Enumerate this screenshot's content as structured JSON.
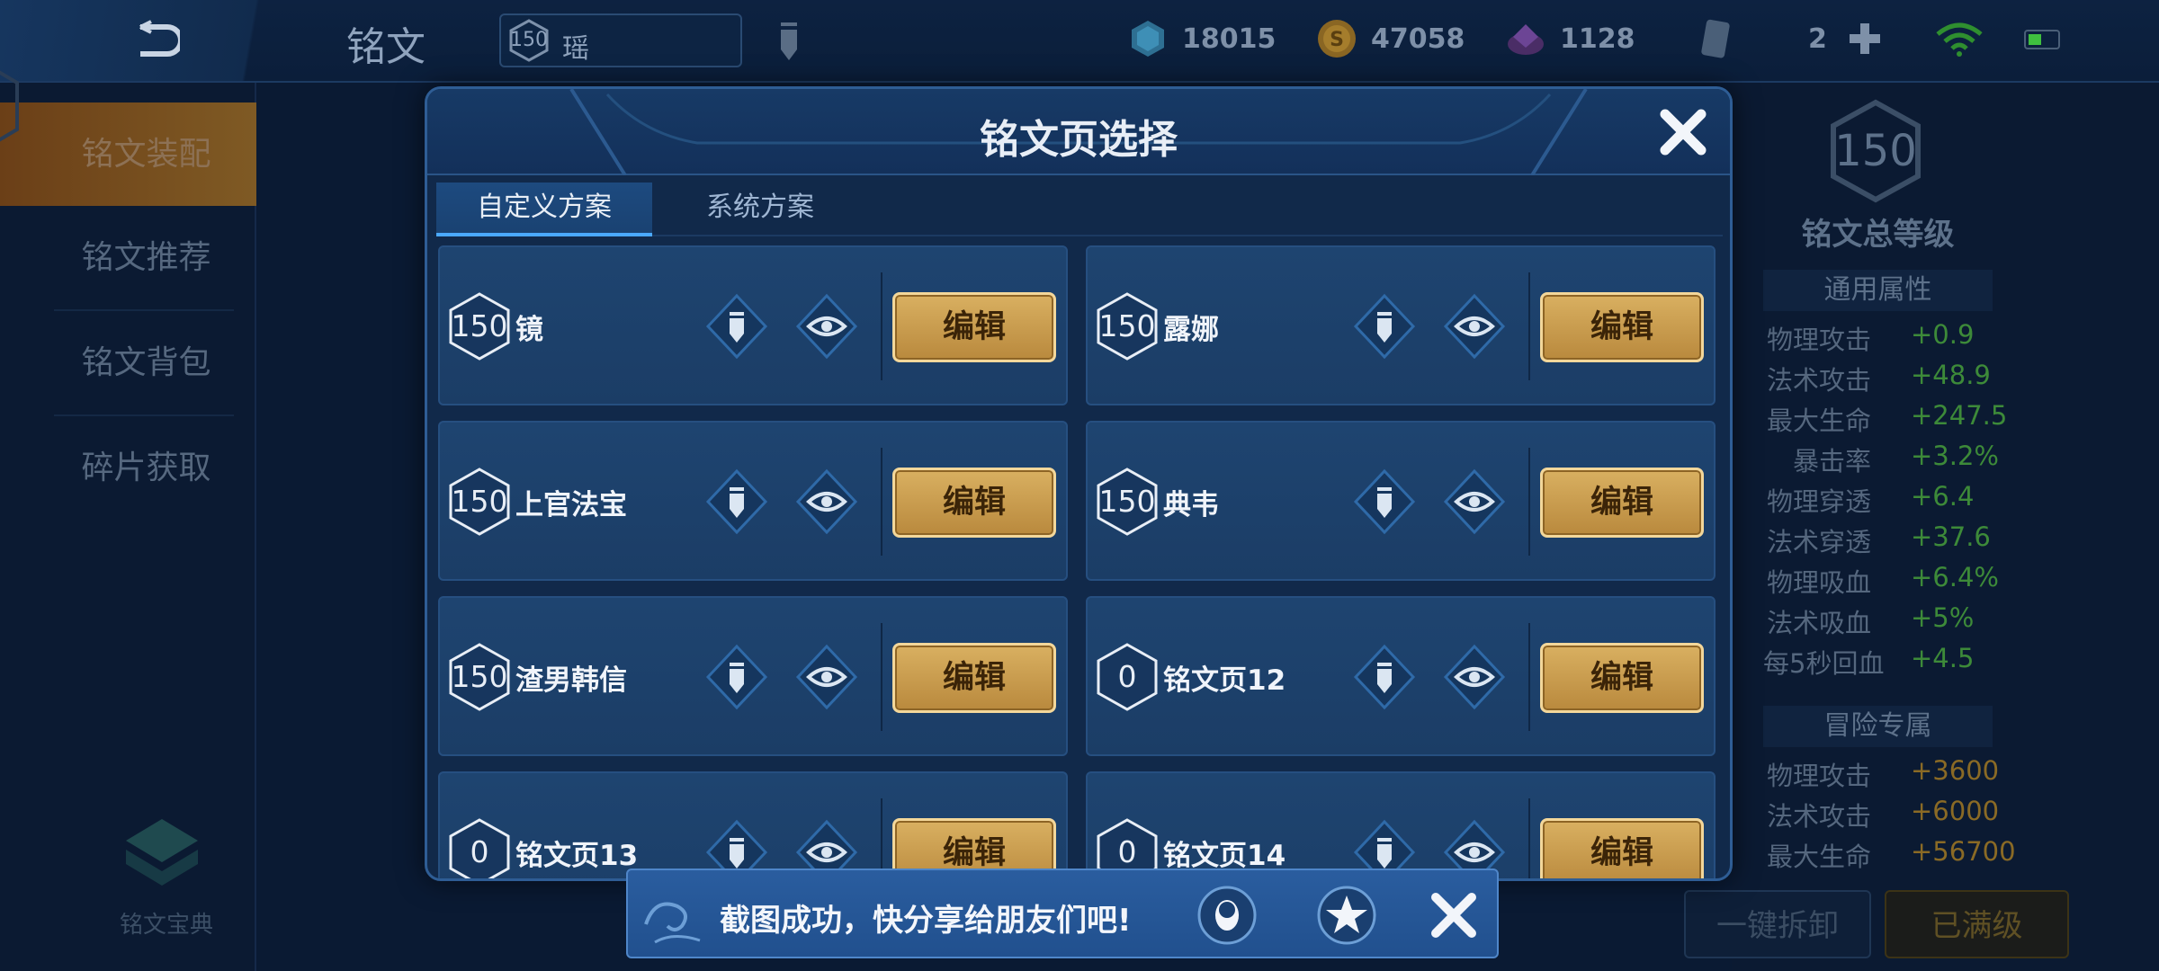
{
  "topbar": {
    "title": "铭文",
    "hero_level": "150",
    "hero_name": "瑶",
    "resources": {
      "diamond": "18015",
      "gold": "47058",
      "gem": "1128",
      "ticket_count": "2"
    }
  },
  "sidebar": {
    "items": [
      {
        "label": "铭文装配",
        "active": true
      },
      {
        "label": "铭文推荐"
      },
      {
        "label": "铭文背包"
      },
      {
        "label": "碎片获取"
      }
    ],
    "codex_label": "铭文宝典"
  },
  "right_panel": {
    "total_level": "150",
    "total_label": "铭文总等级",
    "general_title": "通用属性",
    "general_stats": [
      {
        "k": "物理攻击",
        "v": "+0.9"
      },
      {
        "k": "法术攻击",
        "v": "+48.9"
      },
      {
        "k": "最大生命",
        "v": "+247.5"
      },
      {
        "k": "暴击率",
        "v": "+3.2%"
      },
      {
        "k": "物理穿透",
        "v": "+6.4"
      },
      {
        "k": "法术穿透",
        "v": "+37.6"
      },
      {
        "k": "物理吸血",
        "v": "+6.4%"
      },
      {
        "k": "法术吸血",
        "v": "+5%"
      },
      {
        "k": "每5秒回血",
        "v": "+4.5"
      }
    ],
    "adventure_title": "冒险专属",
    "adventure_stats": [
      {
        "k": "物理攻击",
        "v": "+3600"
      },
      {
        "k": "法术攻击",
        "v": "+6000"
      },
      {
        "k": "最大生命",
        "v": "+56700"
      }
    ],
    "btn_dismantle": "一键拆卸",
    "btn_maxed": "已满级"
  },
  "modal": {
    "title": "铭文页选择",
    "tabs": [
      "自定义方案",
      "系统方案"
    ],
    "edit_label": "编辑",
    "pages": [
      {
        "level": "150",
        "name": "镜"
      },
      {
        "level": "150",
        "name": "露娜"
      },
      {
        "level": "150",
        "name": "上官法宝"
      },
      {
        "level": "150",
        "name": "典韦"
      },
      {
        "level": "150",
        "name": "渣男韩信"
      },
      {
        "level": "0",
        "name": "铭文页12"
      },
      {
        "level": "0",
        "name": "铭文页13"
      },
      {
        "level": "0",
        "name": "铭文页14"
      }
    ]
  },
  "toast": {
    "message": "截图成功，快分享给朋友们吧!"
  },
  "colors": {
    "gold_button": "#d9b061",
    "panel_blue": "#1e4470",
    "stat_green": "#3d8a39"
  }
}
